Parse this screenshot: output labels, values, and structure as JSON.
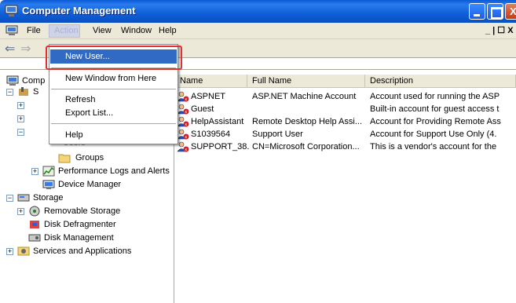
{
  "window": {
    "title": "Computer Management",
    "min_glyph": "_",
    "max_glyph": "□",
    "close_glyph": "X"
  },
  "menubar": {
    "items": [
      "File",
      "Action",
      "View",
      "Window",
      "Help"
    ],
    "mdi_controls": "_ | ☐ X"
  },
  "toolbar": {
    "back": "⇐",
    "forward": "⇒"
  },
  "action_menu": {
    "items": [
      {
        "label": "New User..."
      },
      {
        "label": "New Window from Here"
      },
      {
        "label": "Refresh"
      },
      {
        "label": "Export List..."
      },
      {
        "label": "Help"
      }
    ]
  },
  "tree": {
    "root_partial": "Comp",
    "partial_s": "S",
    "users": "Users",
    "groups": "Groups",
    "perf": "Performance Logs and Alerts",
    "device_manager": "Device Manager",
    "storage": "Storage",
    "removable_storage": "Removable Storage",
    "disk_defrag": "Disk Defragmenter",
    "disk_mgmt": "Disk Management",
    "services": "Services and Applications"
  },
  "list": {
    "columns": [
      "Name",
      "Full Name",
      "Description"
    ],
    "rows": [
      {
        "name": "ASPNET",
        "full_name": "ASP.NET Machine Account",
        "description": "Account used for running the ASP"
      },
      {
        "name": "Guest",
        "full_name": "",
        "description": "Built-in account for guest access t"
      },
      {
        "name": "HelpAssistant",
        "full_name": "Remote Desktop Help Assi...",
        "description": "Account for Providing Remote Ass"
      },
      {
        "name": "S1039564",
        "full_name": "Support User",
        "description": "Account for Support Use Only (4."
      },
      {
        "name": "SUPPORT_38...",
        "full_name": "CN=Microsoft Corporation...",
        "description": "This is a vendor's account for the"
      }
    ]
  },
  "colors": {
    "title_blue": "#0a5ad6",
    "menu_bg": "#ece9d8",
    "highlight": "#316ac5",
    "callout_red": "#e03030"
  }
}
